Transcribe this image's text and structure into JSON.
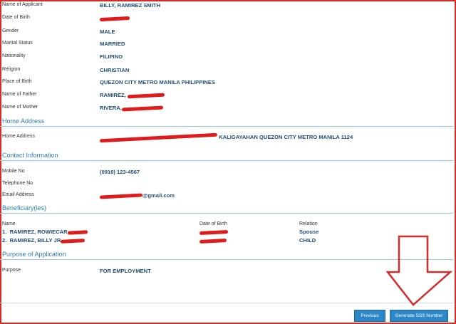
{
  "personal": {
    "name_label": "Name of Applicant",
    "name_value": "BILLY, RAMIREZ SMITH",
    "dob_label": "Date of Birth",
    "gender_label": "Gender",
    "gender_value": "MALE",
    "marital_label": "Marital Status",
    "marital_value": "MARRIED",
    "nationality_label": "Nationality",
    "nationality_value": "FILIPINO",
    "religion_label": "Religion",
    "religion_value": "CHRISTIAN",
    "pob_label": "Place of Birth",
    "pob_value": "QUEZON CITY METRO MANILA PHILIPPINES",
    "father_label": "Name of Father",
    "father_value": "RAMIREZ,",
    "mother_label": "Name of Mother",
    "mother_value": "RIVERA,"
  },
  "home": {
    "section_title": "Home Address",
    "address_label": "Home Address",
    "address_value": "KALIGAYAHAN QUEZON CITY METRO MANILA 1124"
  },
  "contact": {
    "section_title": "Contact Information",
    "mobile_label": "Mobile No",
    "mobile_value": "(0910) 123-4567",
    "telephone_label": "Telephone No",
    "email_label": "Email Address",
    "email_value": "@gmail.com"
  },
  "beneficiaries": {
    "section_title": "Beneficiary(ies)",
    "col_name": "Name",
    "col_dob": "Date of Birth",
    "col_relation": "Relation",
    "rows": [
      {
        "num": "1.",
        "name": "RAMIREZ, ROWIECAR",
        "relation": "Spouse"
      },
      {
        "num": "2.",
        "name": "RAMIREZ, BILLY JR",
        "relation": "CHILD"
      }
    ]
  },
  "purpose": {
    "section_title": "Purpose of Application",
    "purpose_label": "Purpose",
    "purpose_value": "FOR EMPLOYMENT"
  },
  "buttons": {
    "previous": "Previous",
    "generate": "Generate SSS Number"
  },
  "colors": {
    "accent": "#2f7eb8",
    "value_text": "#1f4e79",
    "button": "#2b87c8",
    "annotation": "#d62b2b"
  },
  "icons": {
    "annotation_arrow": "down-arrow-icon"
  }
}
